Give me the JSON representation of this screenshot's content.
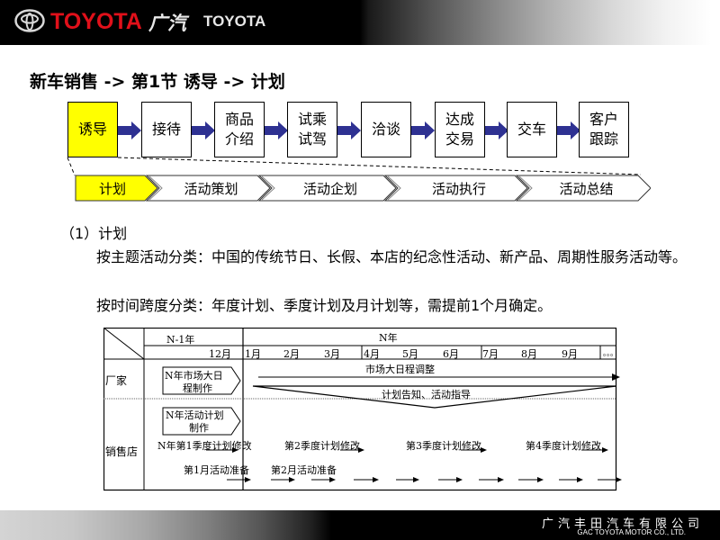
{
  "header": {
    "brand_text": "TOYOTA",
    "gac_cn": "广汽",
    "gac_en": "TOYOTA",
    "icons": [
      "toyota-emblem-icon"
    ]
  },
  "title": "新车销售 -> 第1节 诱导 -> 计划",
  "process_steps": [
    {
      "label": "诱导",
      "active": true
    },
    {
      "label": "接待",
      "active": false
    },
    {
      "label": "商品\n介绍",
      "active": false
    },
    {
      "label": "试乘\n试驾",
      "active": false
    },
    {
      "label": "洽谈",
      "active": false
    },
    {
      "label": "达成\n交易",
      "active": false
    },
    {
      "label": "交车",
      "active": false
    },
    {
      "label": "客户\n跟踪",
      "active": false
    }
  ],
  "sub_steps": [
    {
      "label": "计划",
      "active": true
    },
    {
      "label": "活动策划",
      "active": false
    },
    {
      "label": "活动企划",
      "active": false
    },
    {
      "label": "活动执行",
      "active": false
    },
    {
      "label": "活动总结",
      "active": false
    }
  ],
  "colors": {
    "active_fill": "#ffff00",
    "arrow_fill": "#2e3192",
    "brand_red": "#e0101a"
  },
  "section": {
    "heading": "（1）计划",
    "paragraphs": [
      "按主题活动分类：中国的传统节日、长假、本店的纪念性活动、新产品、周期性服务活动等。",
      "按时间跨度分类：年度计划、季度计划及月计划等，需提前1个月确定。"
    ]
  },
  "timeline_table": {
    "year_prev": "N-1年",
    "year_curr": "N年",
    "month_prev": "12月",
    "months": [
      "1月",
      "2月",
      "3月",
      "4月",
      "5月",
      "6月",
      "7月",
      "8月",
      "9月",
      "。。。"
    ],
    "rows": [
      "厂家",
      "销售店"
    ],
    "maker": {
      "box": "N年市场大日程制作",
      "box_lines": [
        "N年市场大日",
        "程制作"
      ],
      "arrow_label": "市场大日程调整",
      "triangle_label": "计划告知、活动指导"
    },
    "dealer": {
      "box_lines": [
        "N年活动计划",
        "制作"
      ],
      "quarter_labels": [
        "N年第1季度计划修改",
        "第2季度计划修改",
        "第3季度计划修改",
        "第4季度计划修改"
      ],
      "month_labels": [
        "第1月活动准备",
        "第2月活动准备"
      ]
    }
  },
  "footer": {
    "company_cn": "广汽丰田汽车有限公司",
    "company_en": "GAC TOYOTA MOTOR CO., LTD."
  }
}
